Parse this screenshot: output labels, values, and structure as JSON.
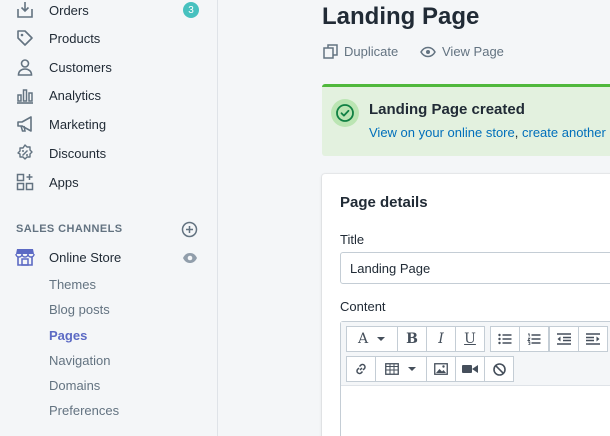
{
  "sidebar": {
    "items": [
      {
        "label": "Orders",
        "icon": "orders-icon",
        "badge": "3"
      },
      {
        "label": "Products",
        "icon": "products-tag-icon"
      },
      {
        "label": "Customers",
        "icon": "customers-icon"
      },
      {
        "label": "Analytics",
        "icon": "analytics-icon"
      },
      {
        "label": "Marketing",
        "icon": "marketing-megaphone-icon"
      },
      {
        "label": "Discounts",
        "icon": "discounts-icon"
      },
      {
        "label": "Apps",
        "icon": "apps-icon"
      }
    ],
    "sales_channels_title": "SALES CHANNELS",
    "online_store": {
      "label": "Online Store",
      "icon": "store-icon"
    },
    "sub_items": [
      {
        "label": "Themes"
      },
      {
        "label": "Blog posts"
      },
      {
        "label": "Pages",
        "active": true
      },
      {
        "label": "Navigation"
      },
      {
        "label": "Domains"
      },
      {
        "label": "Preferences"
      }
    ]
  },
  "main": {
    "title": "Landing Page",
    "actions": {
      "duplicate": "Duplicate",
      "view_page": "View Page"
    },
    "banner": {
      "title": "Landing Page created",
      "link_view": "View on your online store",
      "separator": ",",
      "link_create": "create another pa"
    },
    "card": {
      "title": "Page details",
      "title_label": "Title",
      "title_value": "Landing Page",
      "content_label": "Content"
    },
    "toolbar": {
      "font_label": "A",
      "bold": "B",
      "italic": "I",
      "underline": "U"
    }
  },
  "colors": {
    "accent": "#5c6ac4",
    "badge": "#47c1bf",
    "success_border": "#50b83c",
    "success_bg": "#e3f1df",
    "link": "#006fbb"
  }
}
